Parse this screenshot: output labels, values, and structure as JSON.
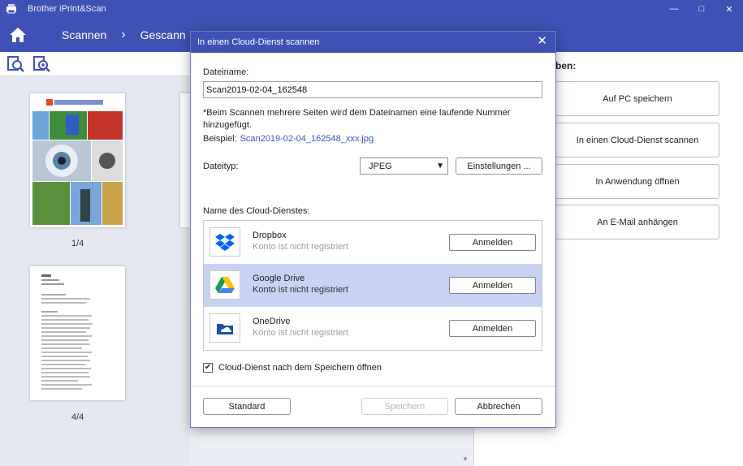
{
  "app": {
    "title": "Brother iPrint&Scan"
  },
  "window_controls": {
    "minimize": "—",
    "maximize": "□",
    "close": "✕"
  },
  "nav": {
    "item1": "Scannen",
    "separator": "›",
    "item2": "Gescann"
  },
  "thumbnails": [
    {
      "label": "1/4"
    },
    {
      "label": "4/4"
    }
  ],
  "right_panel": {
    "heading": "ben:",
    "actions": [
      "Auf PC speichern",
      "In einen Cloud-Dienst scannen",
      "In Anwendung öffnen",
      "An E-Mail anhängen"
    ]
  },
  "dialog": {
    "title": "In einen Cloud-Dienst scannen",
    "close": "✕",
    "filename_label": "Dateiname:",
    "filename_value": "Scan2019-02-04_162548",
    "note": "*Beim Scannen mehrere Seiten wird dem Dateinamen eine laufende Nummer hinzugefügt.",
    "example_label": "Beispiel:",
    "example_value": "Scan2019-02-04_162548_xxx.jpg",
    "filetype_label": "Dateityp:",
    "filetype_value": "JPEG",
    "settings_button": "Einstellungen ...",
    "services_label": "Name des Cloud-Dienstes:",
    "services": [
      {
        "name": "Dropbox",
        "status": "Konto ist nicht registriert",
        "button": "Anmelden",
        "selected": false,
        "icon": "dropbox-icon"
      },
      {
        "name": "Google Drive",
        "status": "Konto ist nicht registriert",
        "button": "Anmelden",
        "selected": true,
        "icon": "google-drive-icon"
      },
      {
        "name": "OneDrive",
        "status": "Konto ist nicht registriert",
        "button": "Anmelden",
        "selected": false,
        "icon": "onedrive-icon"
      }
    ],
    "open_after_save": {
      "label": "Cloud-Dienst nach dem Speichern öffnen",
      "checked": true
    },
    "buttons": {
      "default": "Standard",
      "save": "Speichern",
      "cancel": "Abbrechen"
    }
  },
  "colors": {
    "accent": "#3f51b5",
    "selected_row": "#c8d2f3",
    "link": "#3a55c4"
  }
}
